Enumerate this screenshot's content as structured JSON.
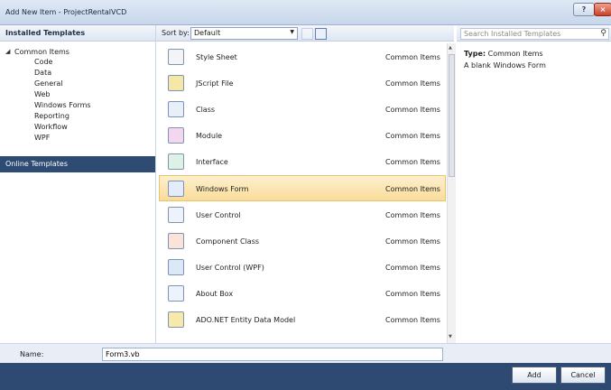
{
  "window": {
    "title": "Add New Item - ProjectRentalVCD"
  },
  "left": {
    "header": "Installed Templates",
    "tree_root": "Common Items",
    "children": [
      "Code",
      "Data",
      "General",
      "Web",
      "Windows Forms",
      "Reporting",
      "Workflow",
      "WPF"
    ],
    "online": "Online Templates"
  },
  "sort": {
    "label": "Sort by:",
    "value": "Default"
  },
  "search": {
    "placeholder": "Search Installed Templates"
  },
  "items": [
    {
      "name": "Style Sheet",
      "category": "Common Items"
    },
    {
      "name": "JScript File",
      "category": "Common Items"
    },
    {
      "name": "Class",
      "category": "Common Items"
    },
    {
      "name": "Module",
      "category": "Common Items"
    },
    {
      "name": "Interface",
      "category": "Common Items"
    },
    {
      "name": "Windows Form",
      "category": "Common Items"
    },
    {
      "name": "User Control",
      "category": "Common Items"
    },
    {
      "name": "Component Class",
      "category": "Common Items"
    },
    {
      "name": "User Control (WPF)",
      "category": "Common Items"
    },
    {
      "name": "About Box",
      "category": "Common Items"
    },
    {
      "name": "ADO.NET Entity Data Model",
      "category": "Common Items"
    }
  ],
  "details": {
    "type_label": "Type:",
    "type_value": "Common Items",
    "description": "A blank Windows Form"
  },
  "name_field": {
    "label": "Name:",
    "value": "Form3.vb"
  },
  "buttons": {
    "add": "Add",
    "cancel": "Cancel"
  },
  "colors": {
    "selection": "#f9dc99",
    "online_bg": "#2e4b73",
    "footer_bg": "#2f4a72"
  }
}
